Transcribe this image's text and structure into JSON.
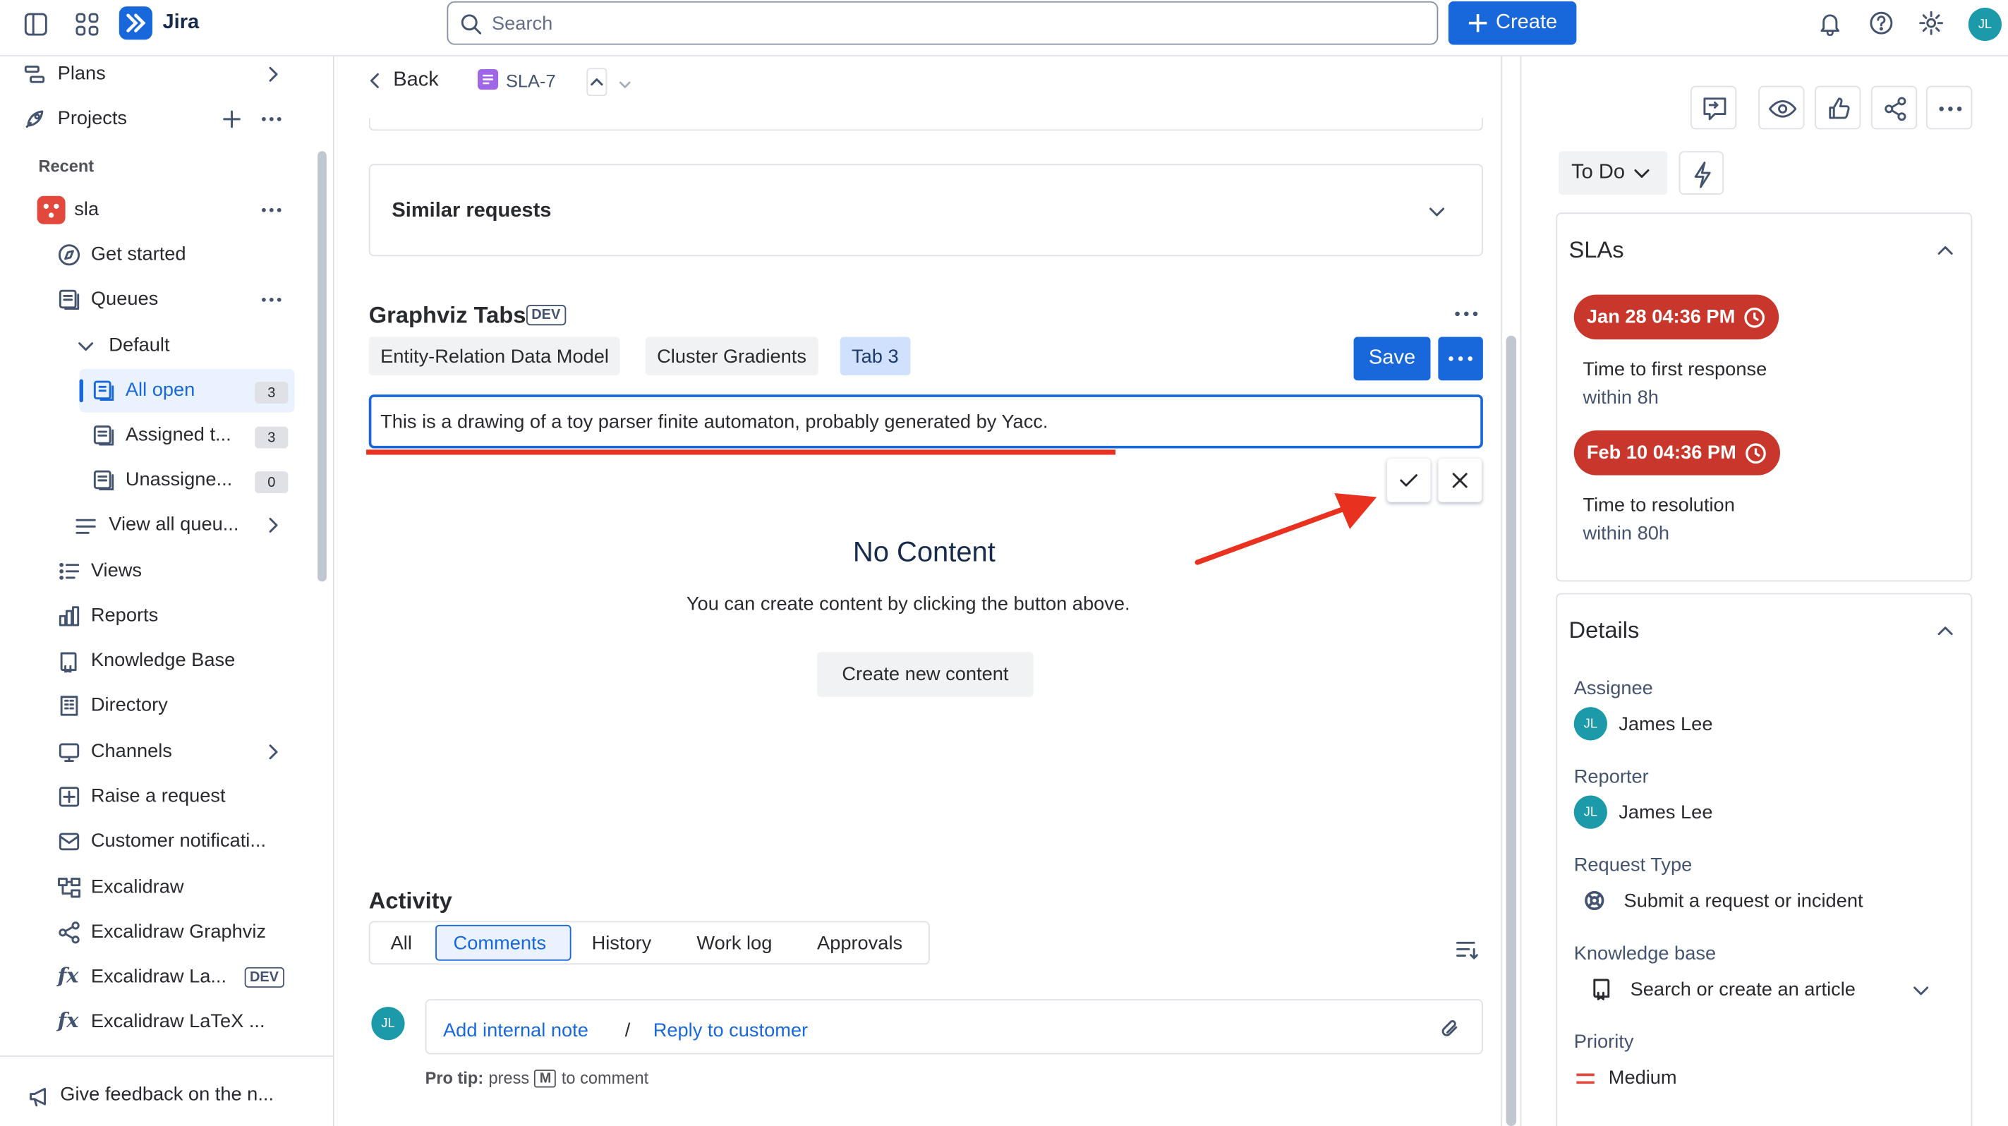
{
  "app": {
    "name": "Jira"
  },
  "search": {
    "placeholder": "Search"
  },
  "header": {
    "create_label": "Create",
    "avatar_initials": "JL"
  },
  "sidebar": {
    "plans": "Plans",
    "projects": "Projects",
    "recent": "Recent",
    "project_name": "sla",
    "get_started": "Get started",
    "queues": "Queues",
    "default": "Default",
    "queue_items": [
      {
        "label": "All open",
        "count": "3"
      },
      {
        "label": "Assigned t...",
        "count": "3"
      },
      {
        "label": "Unassigne...",
        "count": "0"
      }
    ],
    "view_all_queues": "View all queu...",
    "views": "Views",
    "reports": "Reports",
    "knowledge_base": "Knowledge Base",
    "directory": "Directory",
    "channels": "Channels",
    "raise_request": "Raise a request",
    "customer_notifications": "Customer notificati...",
    "excalidraw": "Excalidraw",
    "excalidraw_graphviz": "Excalidraw Graphviz",
    "excalidraw_la": "Excalidraw La...",
    "excalidraw_la_badge": "DEV",
    "excalidraw_latex": "Excalidraw LaTeX ...",
    "feedback": "Give feedback on the n..."
  },
  "issue": {
    "back_label": "Back",
    "key": "SLA-7",
    "similar_requests": "Similar requests",
    "graphviz_title": "Graphviz Tabs",
    "graphviz_badge": "DEV",
    "tabs": [
      "Entity-Relation Data Model",
      "Cluster Gradients",
      "Tab 3"
    ],
    "save_label": "Save",
    "text_value": "This is a drawing of a toy parser finite automaton, probably generated by Yacc.",
    "empty_title": "No Content",
    "empty_desc": "You can create content by clicking the button above.",
    "create_content": "Create new content"
  },
  "activity": {
    "title": "Activity",
    "tabs": [
      "All",
      "Comments",
      "History",
      "Work log",
      "Approvals"
    ],
    "selected_tab": "Comments",
    "add_internal_note": "Add internal note",
    "separator": "/",
    "reply_to_customer": "Reply to customer",
    "pro_tip_bold": "Pro tip:",
    "pro_tip_press": "press",
    "pro_tip_key": "M",
    "pro_tip_end": "to comment"
  },
  "status": {
    "label": "To Do"
  },
  "slas": {
    "title": "SLAs",
    "items": [
      {
        "date": "Jan 28 04:36 PM",
        "name": "Time to first response",
        "goal": "within 8h"
      },
      {
        "date": "Feb 10 04:36 PM",
        "name": "Time to resolution",
        "goal": "within 80h"
      }
    ]
  },
  "details": {
    "title": "Details",
    "assignee_label": "Assignee",
    "assignee": "James Lee",
    "reporter_label": "Reporter",
    "reporter": "James Lee",
    "request_type_label": "Request Type",
    "request_type": "Submit a request or incident",
    "kb_label": "Knowledge base",
    "kb_value": "Search or create an article",
    "priority_label": "Priority",
    "priority": "Medium"
  },
  "colors": {
    "brand": "#1868db",
    "sla_red": "#c9372c",
    "annotation_red": "#e8321f",
    "avatar": "#1d9aaa"
  }
}
